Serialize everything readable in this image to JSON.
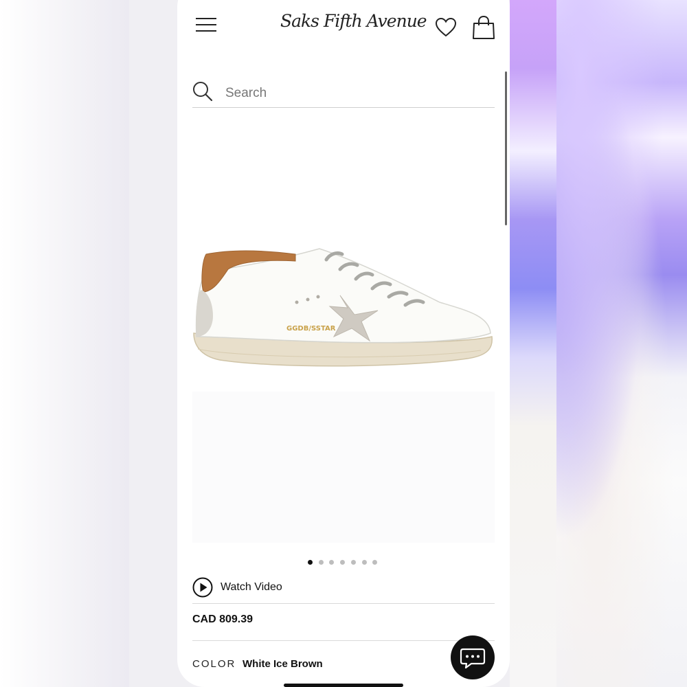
{
  "header": {
    "logo_text": "Saks Fifth Avenue"
  },
  "search": {
    "placeholder": "Search"
  },
  "product": {
    "image_alt": "White leather sneaker with brown heel tab and grey star",
    "shoe_print": "GGDB/SSTAR",
    "gallery_count": 7,
    "gallery_active_index": 0
  },
  "watch_video": {
    "label": "Watch Video"
  },
  "price": {
    "text": "CAD 809.39"
  },
  "color": {
    "label": "COLOR",
    "value": "White Ice Brown"
  },
  "colors": {
    "background": "#ffffff",
    "text": "#111111",
    "heel_tab": "#b8773f",
    "star": "#cfcac2"
  },
  "icons": {
    "menu": "hamburger-icon",
    "wishlist": "heart-icon",
    "bag": "shopping-bag-icon",
    "search": "search-icon",
    "video": "play-icon",
    "chat": "chat-icon"
  }
}
